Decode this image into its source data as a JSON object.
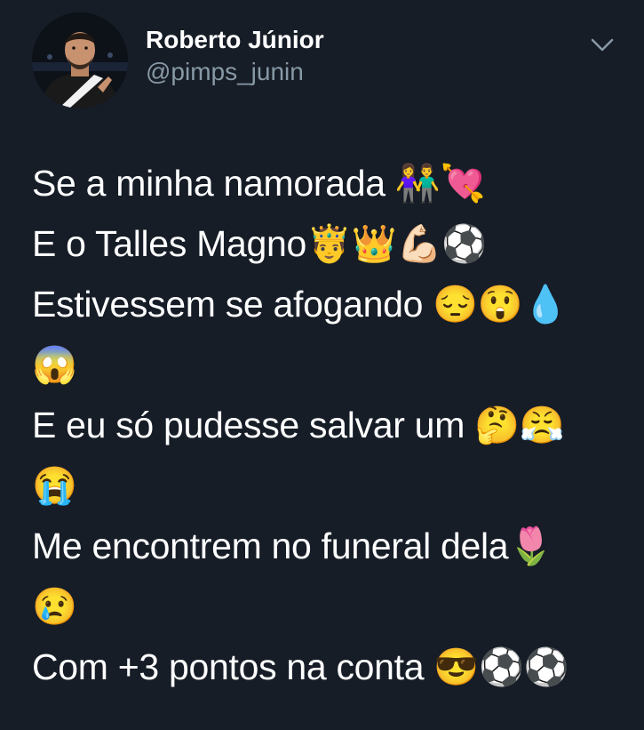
{
  "tweet": {
    "author": {
      "display_name": "Roberto Júnior",
      "handle": "@pimps_junin",
      "avatar_icon": "profile-photo"
    },
    "menu_icon": "chevron-down-icon",
    "lines": [
      "Se a minha namorada 👫💘",
      "E o Talles Magno🤴👑💪🏻⚽",
      "Estivessem se afogando 😔😲💧",
      "😱",
      "E eu só pudesse salvar um 🤔😤",
      "😭",
      "Me encontrem no funeral dela🌷",
      "😢",
      "Com +3 pontos na conta 😎⚽⚽"
    ]
  },
  "colors": {
    "background": "#161d27",
    "text": "#ffffff",
    "secondary_text": "#8899a6"
  }
}
